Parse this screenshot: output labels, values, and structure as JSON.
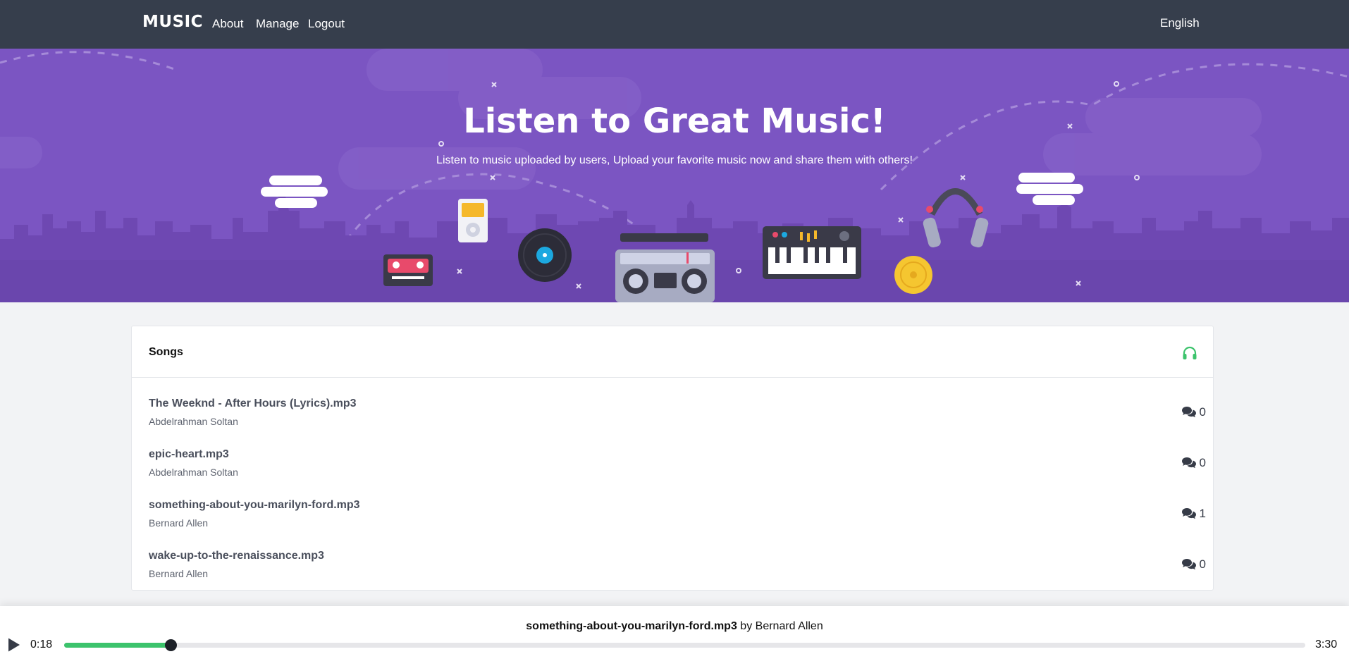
{
  "navbar": {
    "brand": "MUSIC",
    "links": [
      "About",
      "Manage",
      "Logout"
    ],
    "language": "English"
  },
  "hero": {
    "title": "Listen to Great Music!",
    "subtitle": "Listen to music uploaded by users, Upload your favorite music now and share them with others!"
  },
  "songs_card": {
    "title": "Songs",
    "header_icon": "headphones-icon",
    "songs": [
      {
        "title": "The Weeknd - After Hours (Lyrics).mp3",
        "artist": "Abdelrahman Soltan",
        "comments": "0"
      },
      {
        "title": "epic-heart.mp3",
        "artist": "Abdelrahman Soltan",
        "comments": "0"
      },
      {
        "title": "something-about-you-marilyn-ford.mp3",
        "artist": "Bernard Allen",
        "comments": "1"
      },
      {
        "title": "wake-up-to-the-renaissance.mp3",
        "artist": "Bernard Allen",
        "comments": "0"
      }
    ]
  },
  "player": {
    "title": "something-about-you-marilyn-ford.mp3",
    "by": "by",
    "artist": "Bernard Allen",
    "current_time": "0:18",
    "total_time": "3:30",
    "progress": 0.0857
  },
  "colors": {
    "navbar": "#363e4c",
    "hero": "#7b55c2",
    "accent_green": "#3cc36c"
  }
}
